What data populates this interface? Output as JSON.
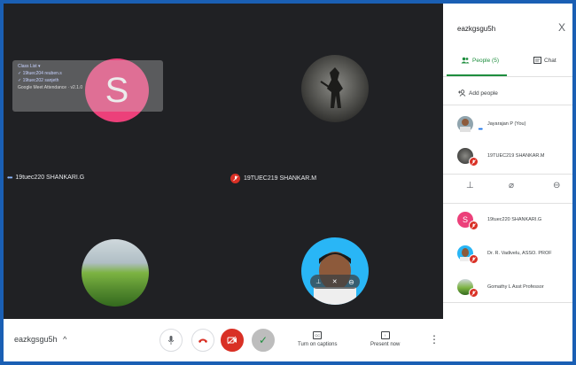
{
  "meeting": {
    "code": "eazkgsgu5h",
    "code_arrow": "^"
  },
  "overlay": {
    "lines": [
      "Class List ▾",
      "✓ 19tuec204 reuben.s",
      "✓ 19tuec202 sanjeth",
      "Google Meet Attendance · v2.1.0"
    ]
  },
  "tiles": [
    {
      "name": "19tuec220 SHANKARI.G",
      "avatar_letter": "S",
      "status": "speaking"
    },
    {
      "name": "19TUEC219 SHANKAR.M",
      "status": "muted",
      "image_icon": "warrior-image"
    },
    {
      "name": "",
      "image_icon": "landscape-image"
    },
    {
      "name": "",
      "image_icon": "person-photo"
    }
  ],
  "controls": {
    "captions_label": "Turn on captions",
    "captions_icon_text": "CC",
    "present_label": "Present now",
    "more_icon": "⋮"
  },
  "panel": {
    "title": "eazkgsgu5h",
    "close": "X",
    "tabs": [
      {
        "label": "People (5)",
        "icon": "people-icon",
        "active": true
      },
      {
        "label": "Chat",
        "icon": "chat-icon",
        "active": false
      }
    ],
    "add_people": "Add people",
    "people_top": [
      {
        "name": "Jayarajan P (You)",
        "avatar": "photo",
        "badge": "dots"
      },
      {
        "name": "19TUEC219 SHANKAR.M",
        "avatar": "warrior",
        "badge": "muted"
      }
    ],
    "people_bottom": [
      {
        "name": "19tuec220 SHANKARI.G",
        "avatar_letter": "S",
        "badge": "muted"
      },
      {
        "name": "Dr. R. Vadivelu, ASSO. PROF",
        "avatar": "photo",
        "badge": "muted"
      },
      {
        "name": "Gomathy L Asst Professor",
        "avatar": "landscape",
        "badge": "muted"
      }
    ]
  },
  "colors": {
    "accent": "#1e8e3e",
    "muted": "#d93025",
    "avatar_pink": "#ec407a",
    "background": "#202124"
  }
}
